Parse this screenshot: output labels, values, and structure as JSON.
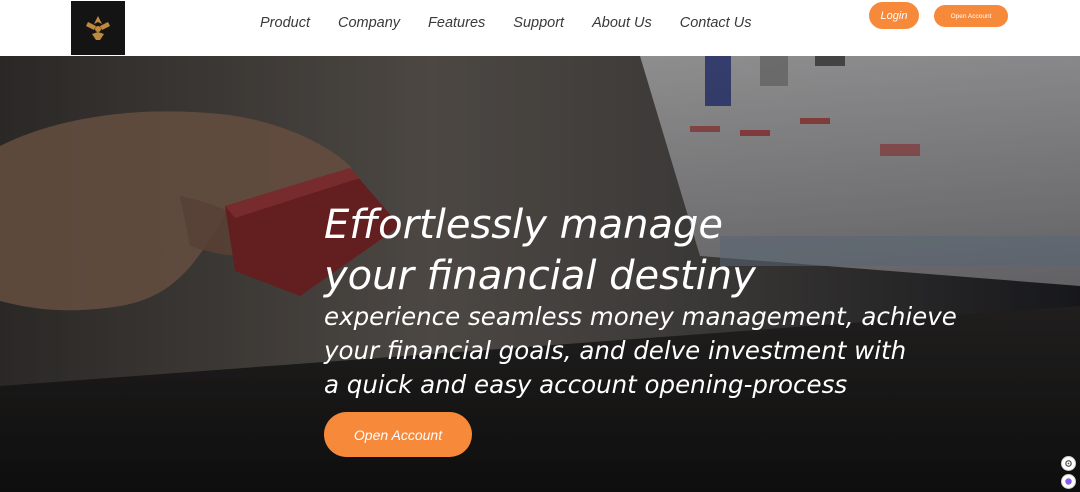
{
  "nav": {
    "logo_alt": "logo",
    "links": [
      {
        "label": "Product"
      },
      {
        "label": "Company"
      },
      {
        "label": "Features"
      },
      {
        "label": "Support"
      },
      {
        "label": "About Us"
      },
      {
        "label": "Contact Us"
      }
    ],
    "login_label": "Login",
    "open_account_label": "Open Account"
  },
  "hero": {
    "title_line1": "Effortlessly manage",
    "title_line2": "your financial destiny",
    "subtitle_line1": "experience seamless money management, achieve",
    "subtitle_line2": "your financial goals, and delve investment with",
    "subtitle_line3": "a quick and easy account opening-process",
    "cta_label": "Open Account",
    "background_icon": "credit-card-laptop-photo"
  },
  "colors": {
    "accent": "#f7893a",
    "header_bg": "#ffffff",
    "hero_text": "#ffffff",
    "nav_text": "#3a3a3a"
  },
  "widgets": [
    {
      "icon": "settings-widget-icon"
    },
    {
      "icon": "chat-widget-icon"
    }
  ]
}
